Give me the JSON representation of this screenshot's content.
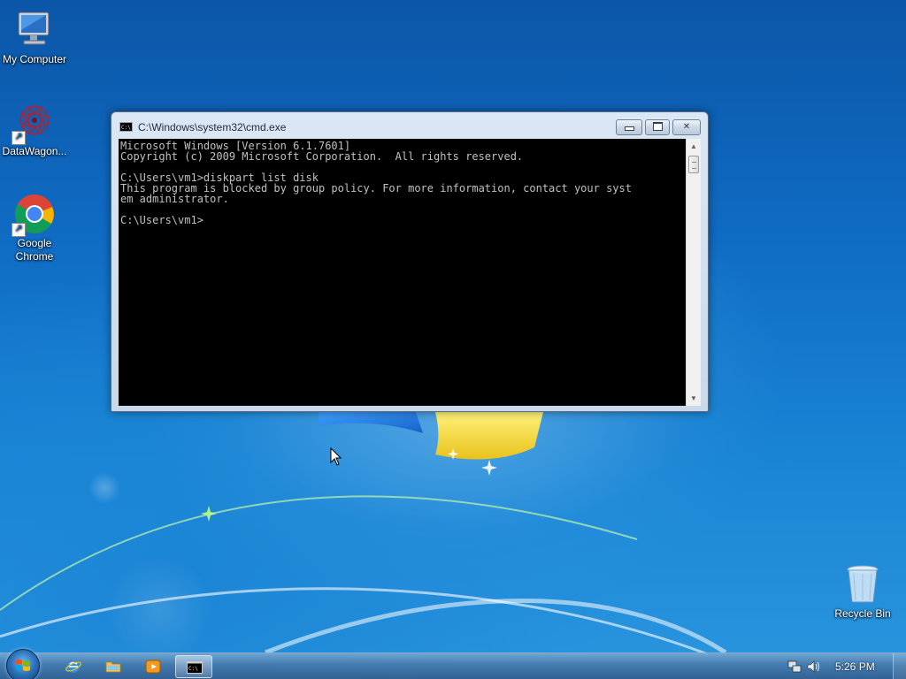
{
  "desktop": {
    "icons": [
      {
        "label": "My Computer",
        "icon": "computer-icon"
      },
      {
        "label": "DataWagon...",
        "icon": "datawagon-icon"
      },
      {
        "label": "Google Chrome",
        "icon": "chrome-icon"
      },
      {
        "label": "Recycle Bin",
        "icon": "recycle-bin-icon"
      }
    ]
  },
  "cmd_window": {
    "title": "C:\\Windows\\system32\\cmd.exe",
    "icon_text": "C:\\",
    "min_label": "minimize",
    "max_label": "maximize",
    "close_label": "✕",
    "lines": [
      "Microsoft Windows [Version 6.1.7601]",
      "Copyright (c) 2009 Microsoft Corporation.  All rights reserved.",
      "",
      "C:\\Users\\vm1>diskpart list disk",
      "This program is blocked by group policy. For more information, contact your syst",
      "em administrator.",
      "",
      "C:\\Users\\vm1>"
    ]
  },
  "taskbar": {
    "items": [
      "internet-explorer-icon",
      "windows-explorer-icon",
      "media-player-icon",
      "command-prompt-icon"
    ],
    "active_item": "command-prompt-icon",
    "tray_icons": [
      "network-icon",
      "volume-icon"
    ],
    "clock": "5:26 PM"
  },
  "colors": {
    "console_background": "#000000",
    "console_text": "#c0c0c0",
    "desktop_blue": "#1a86d6",
    "taskbar": "#4a7bb0"
  }
}
